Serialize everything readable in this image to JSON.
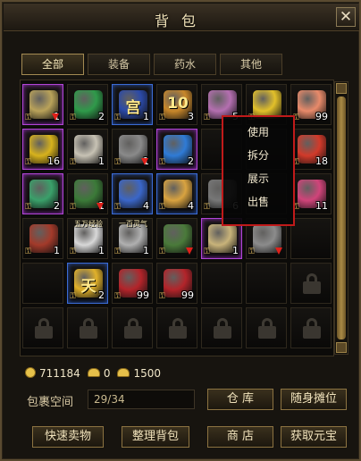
{
  "window": {
    "title": "背包",
    "close_glyph": "✕"
  },
  "tabs": [
    {
      "label": "全部",
      "active": true
    },
    {
      "label": "装备",
      "active": false
    },
    {
      "label": "药水",
      "active": false
    },
    {
      "label": "其他",
      "active": false
    }
  ],
  "grid": {
    "rows": [
      [
        {
          "icon": "sword-icon",
          "color": "#b9a25a",
          "border": "rare",
          "qty": "1",
          "arrow": true
        },
        {
          "icon": "green-scroll-icon",
          "color": "#2f9a4a",
          "border": "none",
          "qty": "2",
          "arrow": false
        },
        {
          "icon": "palace-token-icon",
          "color": "#2b4aa8",
          "border": "blue",
          "qty": "1",
          "arrow": false,
          "text": "宫"
        },
        {
          "icon": "lottery-ticket-icon",
          "color": "#c8872a",
          "border": "none",
          "qty": "3",
          "arrow": false,
          "text": "10"
        },
        {
          "icon": "pink-flower-icon",
          "color": "#b46fb0",
          "border": "none",
          "qty": "5",
          "arrow": false
        },
        {
          "icon": "gold-gourd-icon",
          "color": "#e2c02a",
          "border": "none",
          "qty": "",
          "arrow": false
        },
        {
          "icon": "peach-icon",
          "color": "#e88a6a",
          "border": "none",
          "qty": "99",
          "arrow": false
        }
      ],
      [
        {
          "icon": "gold-crystal-icon",
          "color": "#d7b21c",
          "border": "rare",
          "qty": "16",
          "arrow": false
        },
        {
          "icon": "bound-scroll-icon",
          "color": "#c7c2b4",
          "border": "none",
          "qty": "1",
          "arrow": false
        },
        {
          "icon": "chain-bracelet-icon",
          "color": "#8a8a8a",
          "border": "none",
          "qty": "1",
          "arrow": true
        },
        {
          "icon": "blue-gem-icon",
          "color": "#2f7bd6",
          "border": "rare",
          "qty": "2",
          "arrow": false
        },
        {
          "icon": "empty-slot",
          "color": "",
          "border": "none",
          "qty": "",
          "arrow": false
        },
        {
          "icon": "empty-slot",
          "color": "",
          "border": "none",
          "qty": "",
          "arrow": false
        },
        {
          "icon": "red-scroll-icon",
          "color": "#d23a2a",
          "border": "none",
          "qty": "18",
          "arrow": false
        }
      ],
      [
        {
          "icon": "jade-orb-icon",
          "color": "#3aa06a",
          "border": "rare",
          "qty": "2",
          "arrow": false
        },
        {
          "icon": "green-boots-icon",
          "color": "#3b7a38",
          "border": "none",
          "qty": "1",
          "arrow": true
        },
        {
          "icon": "blue-flag-icon",
          "color": "#3a66c8",
          "border": "blue",
          "qty": "4",
          "arrow": false
        },
        {
          "icon": "gold-talisman-icon",
          "color": "#d9a340",
          "border": "blue",
          "qty": "4",
          "arrow": false
        },
        {
          "icon": "gray-stone-icon",
          "color": "#777777",
          "border": "none",
          "qty": "6",
          "arrow": false
        },
        {
          "icon": "empty-slot",
          "color": "",
          "border": "none",
          "qty": "",
          "arrow": false
        },
        {
          "icon": "pink-crystal-icon",
          "color": "#d0447a",
          "border": "none",
          "qty": "11",
          "arrow": false
        }
      ],
      [
        {
          "icon": "red-helmet-icon",
          "color": "#a33a2a",
          "border": "none",
          "qty": "1",
          "arrow": false
        },
        {
          "icon": "taiji-icon",
          "color": "#d8d8d8",
          "border": "none",
          "qty": "1",
          "arrow": false,
          "label": "五万经验"
        },
        {
          "icon": "spirit-orb-icon",
          "color": "#b0b0b0",
          "border": "none",
          "qty": "1",
          "arrow": false,
          "label": "一百灵气"
        },
        {
          "icon": "green-armor-icon",
          "color": "#4a7a3a",
          "border": "none",
          "qty": "",
          "arrow": true
        },
        {
          "icon": "purple-scroll-icon",
          "color": "#c8b37a",
          "border": "rare",
          "qty": "1",
          "arrow": false
        },
        {
          "icon": "claw-weapon-icon",
          "color": "#8c8c8c",
          "border": "none",
          "qty": "",
          "arrow": true
        },
        {
          "icon": "empty-slot",
          "color": "",
          "border": "none",
          "qty": "",
          "arrow": false
        }
      ],
      [
        {
          "icon": "empty-slot",
          "color": "",
          "border": "none",
          "qty": "",
          "arrow": false
        },
        {
          "icon": "heaven-token-icon",
          "color": "#e1b12a",
          "border": "blue",
          "qty": "2",
          "arrow": false,
          "text": "天"
        },
        {
          "icon": "red-gift-box-icon",
          "color": "#b3242a",
          "border": "none",
          "qty": "99",
          "arrow": false
        },
        {
          "icon": "red-gift-box-icon",
          "color": "#b3242a",
          "border": "none",
          "qty": "99",
          "arrow": false
        },
        {
          "icon": "empty-slot",
          "color": "",
          "border": "none",
          "qty": "",
          "arrow": false
        },
        {
          "icon": "empty-slot",
          "color": "",
          "border": "none",
          "qty": "",
          "arrow": false
        },
        {
          "icon": "lock-icon",
          "color": "",
          "border": "none",
          "qty": "",
          "arrow": false
        }
      ],
      [
        {
          "icon": "lock-icon",
          "color": "",
          "border": "none",
          "qty": "",
          "arrow": false
        },
        {
          "icon": "lock-icon",
          "color": "",
          "border": "none",
          "qty": "",
          "arrow": false
        },
        {
          "icon": "lock-icon",
          "color": "",
          "border": "none",
          "qty": "",
          "arrow": false
        },
        {
          "icon": "lock-icon",
          "color": "",
          "border": "none",
          "qty": "",
          "arrow": false
        },
        {
          "icon": "lock-icon",
          "color": "",
          "border": "none",
          "qty": "",
          "arrow": false
        },
        {
          "icon": "lock-icon",
          "color": "",
          "border": "none",
          "qty": "",
          "arrow": false
        },
        {
          "icon": "lock-icon",
          "color": "",
          "border": "none",
          "qty": "",
          "arrow": false
        }
      ]
    ]
  },
  "context_menu": {
    "items": [
      "使用",
      "拆分",
      "展示",
      "出售"
    ],
    "border_color": "#c01a1a"
  },
  "currency": {
    "gold": "711184",
    "bound_ingot": "0",
    "ingot": "1500"
  },
  "capacity": {
    "label": "包裹空间",
    "value": "29/34"
  },
  "buttons": {
    "warehouse": "仓  库",
    "stall": "随身摊位",
    "quick_sell": "快速卖物",
    "sort": "整理背包",
    "shop": "商  店",
    "get_yuanbao": "获取元宝"
  }
}
